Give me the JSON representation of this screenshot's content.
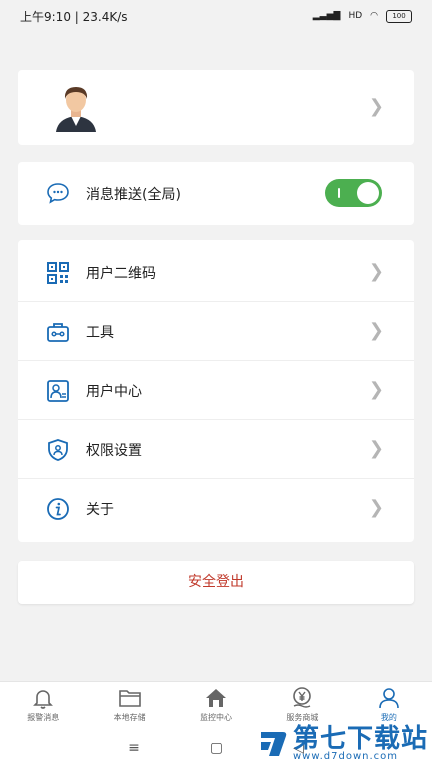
{
  "status_bar": {
    "time_speed": "上午9:10 | 23.4K/s",
    "signal": "HD",
    "battery": "100"
  },
  "profile": {
    "avatar_icon": "user-avatar-icon"
  },
  "push": {
    "label": "消息推送(全局)",
    "enabled": true
  },
  "menu": {
    "items": [
      {
        "label": "用户二维码",
        "icon": "qr-code-icon"
      },
      {
        "label": "工具",
        "icon": "toolbox-icon"
      },
      {
        "label": "用户中心",
        "icon": "user-card-icon"
      },
      {
        "label": "权限设置",
        "icon": "shield-icon"
      },
      {
        "label": "关于",
        "icon": "info-icon"
      }
    ]
  },
  "logout": {
    "label": "安全登出"
  },
  "tabs": [
    {
      "label": "报警消息",
      "icon": "bell-icon"
    },
    {
      "label": "本地存储",
      "icon": "folder-icon"
    },
    {
      "label": "监控中心",
      "icon": "home-icon"
    },
    {
      "label": "服务商城",
      "icon": "yen-coin-icon"
    },
    {
      "label": "我的",
      "icon": "user-icon",
      "active": true
    }
  ],
  "watermark": {
    "title": "第七下载站",
    "url": "www.d7down.com"
  },
  "colors": {
    "accent": "#1a6bb5",
    "toggle_on": "#4caf50",
    "logout": "#c0392b"
  }
}
